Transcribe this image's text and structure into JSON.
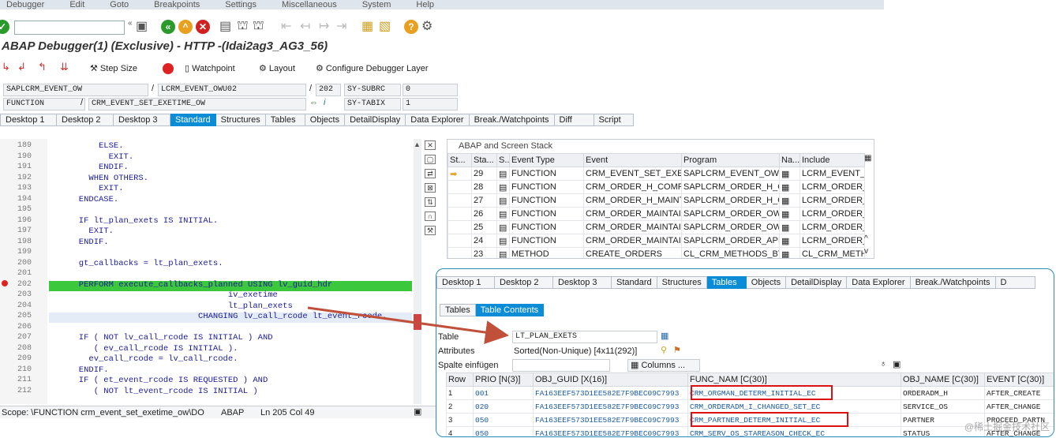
{
  "menu": [
    "Debugger",
    "Edit",
    "Goto",
    "Breakpoints",
    "Settings",
    "Miscellaneous",
    "System",
    "Help"
  ],
  "window_title": "ABAP Debugger(1)  (Exclusive) - HTTP -(Idai2ag3_AG3_56)",
  "app_toolbar": {
    "step_size": "Step Size",
    "watchpoint": "Watchpoint",
    "layout": "Layout",
    "configure": "Configure Debugger Layer"
  },
  "info": {
    "program": "SAPLCRM_EVENT_OW",
    "include": "LCRM_EVENT_OWU02",
    "line": "202",
    "sy_subrc_label": "SY-SUBRC",
    "sy_subrc_value": "0",
    "type": "FUNCTION",
    "name": "CRM_EVENT_SET_EXETIME_OW",
    "sy_tabix_label": "SY-TABIX",
    "sy_tabix_value": "1"
  },
  "main_tabs": [
    "Desktop 1",
    "Desktop 2",
    "Desktop 3",
    "Standard",
    "Structures",
    "Tables",
    "Objects",
    "DetailDisplay",
    "Data Explorer",
    "Break./Watchpoints",
    "Diff",
    "Script"
  ],
  "code": {
    "lines": [
      {
        "n": "189",
        "t": "          ELSE."
      },
      {
        "n": "190",
        "t": "            EXIT."
      },
      {
        "n": "191",
        "t": "          ENDIF."
      },
      {
        "n": "192",
        "t": "        WHEN OTHERS."
      },
      {
        "n": "193",
        "t": "          EXIT."
      },
      {
        "n": "194",
        "t": "      ENDCASE."
      },
      {
        "n": "195",
        "t": ""
      },
      {
        "n": "196",
        "t": "      IF lt_plan_exets IS INITIAL."
      },
      {
        "n": "197",
        "t": "        EXIT."
      },
      {
        "n": "198",
        "t": "      ENDIF."
      },
      {
        "n": "199",
        "t": ""
      },
      {
        "n": "200",
        "t": "      gt_callbacks = lt_plan_exets."
      },
      {
        "n": "201",
        "t": ""
      },
      {
        "n": "202",
        "t": "      PERFORM execute_callbacks_planned USING lv_guid_hdr"
      },
      {
        "n": "203",
        "t": "                                    iv_exetime"
      },
      {
        "n": "204",
        "t": "                                    lt_plan_exets"
      },
      {
        "n": "205",
        "t": "                              CHANGING lv_call_rcode lt_event_rcode."
      },
      {
        "n": "206",
        "t": ""
      },
      {
        "n": "207",
        "t": "      IF ( NOT lv_call_rcode IS INITIAL ) AND"
      },
      {
        "n": "208",
        "t": "         ( ev_call_rcode IS INITIAL )."
      },
      {
        "n": "209",
        "t": "        ev_call_rcode = lv_call_rcode."
      },
      {
        "n": "210",
        "t": "      ENDIF."
      },
      {
        "n": "211",
        "t": "      IF ( et_event_rcode IS REQUESTED ) AND"
      },
      {
        "n": "212",
        "t": "         ( NOT lt_event_rcode IS INITIAL )"
      }
    ]
  },
  "stack": {
    "title": "ABAP and Screen Stack",
    "headers": [
      "St...",
      "Sta...",
      "S...",
      "Event Type",
      "Event",
      "Program",
      "Na...",
      "Include"
    ],
    "rows": [
      [
        "29",
        "FUNCTION",
        "CRM_EVENT_SET_EXETI...",
        "SAPLCRM_EVENT_OW",
        "LCRM_EVENT_O"
      ],
      [
        "28",
        "FUNCTION",
        "CRM_ORDER_H_COMPLE...",
        "SAPLCRM_ORDER_H_OW",
        "LCRM_ORDER_H"
      ],
      [
        "27",
        "FUNCTION",
        "CRM_ORDER_H_MAINTA...",
        "SAPLCRM_ORDER_H_OW",
        "LCRM_ORDER_H"
      ],
      [
        "26",
        "FUNCTION",
        "CRM_ORDER_MAINTAIN...",
        "SAPLCRM_ORDER_OW",
        "LCRM_ORDER_O"
      ],
      [
        "25",
        "FUNCTION",
        "CRM_ORDER_MAINTAIN...",
        "SAPLCRM_ORDER_OW",
        "LCRM_ORDER_O"
      ],
      [
        "24",
        "FUNCTION",
        "CRM_ORDER_MAINTAIN",
        "SAPLCRM_ORDER_API",
        "LCRM_ORDER_A"
      ],
      [
        "23",
        "METHOD",
        "CREATE_ORDERS",
        "CL_CRM_METHODS_BTIL...",
        "CL_CRM_METHO"
      ]
    ]
  },
  "status": {
    "scope": "Scope: \\FUNCTION crm_event_set_exetime_ow\\DO",
    "lang": "ABAP",
    "pos": "Ln 205 Col 49"
  },
  "overlay": {
    "tabs": [
      "Desktop 1",
      "Desktop 2",
      "Desktop 3",
      "Standard",
      "Structures",
      "Tables",
      "Objects",
      "DetailDisplay",
      "Data Explorer",
      "Break./Watchpoints",
      "D"
    ],
    "subtabs": [
      "Tables",
      "Table Contents"
    ],
    "table_label": "Table",
    "table_value": "LT_PLAN_EXETS",
    "attributes_label": "Attributes",
    "attributes_value": "Sorted(Non-Unique) [4x11(292)]",
    "spalte_label": "Spalte einfügen",
    "columns_label": "Columns ...",
    "headers": [
      "Row",
      "PRIO [N(3)]",
      "OBJ_GUID [X(16)]",
      "FUNC_NAM [C(30)]",
      "OBJ_NAME [C(30)]",
      "EVENT [C(30)]"
    ],
    "rows": [
      [
        "1",
        "001",
        "FA163EEF573D1EE582E7F9BEC09C7993",
        "CRM_ORGMAN_DETERM_INITIAL_EC",
        "ORDERADM_H",
        "AFTER_CREATE"
      ],
      [
        "2",
        "020",
        "FA163EEF573D1EE582E7F9BEC09C7993",
        "CRM_ORDERADM_I_CHANGED_SET_EC",
        "SERVICE_OS",
        "AFTER_CHANGE"
      ],
      [
        "3",
        "050",
        "FA163EEF573D1EE582E7F9BEC09C7993",
        "CRM_PARTNER_DETERM_INITIAL_EC",
        "PARTNER",
        "PROCEED_PARTN"
      ],
      [
        "4",
        "050",
        "FA163EEF573D1EE582E7F9BEC09C7993",
        "CRM_SERV_OS_STAREASON_CHECK_EC",
        "STATUS",
        "AFTER_CHANGE"
      ]
    ]
  },
  "watermark": "@稀土掘金技术社区",
  "colors": {
    "accent": "#0a8cd6",
    "highlight": "#3cc83c",
    "redbox": "#dd1111"
  }
}
